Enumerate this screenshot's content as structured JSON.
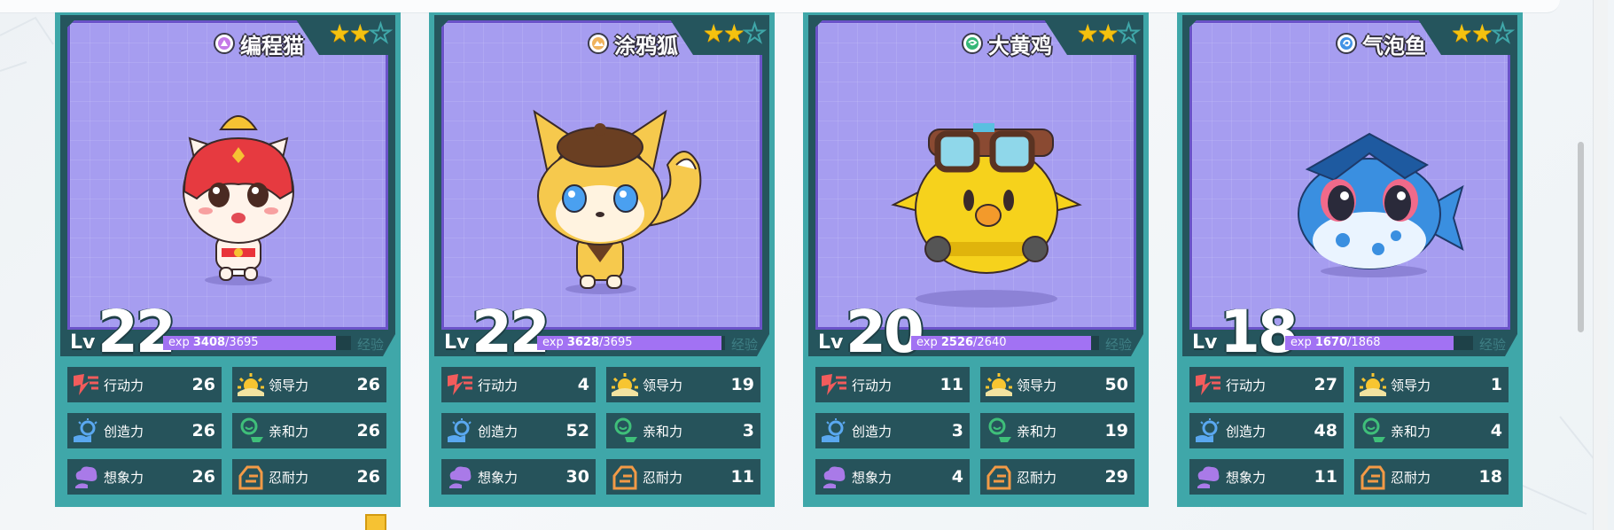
{
  "stat_labels": {
    "action": "行动力",
    "leadership": "领导力",
    "creativity": "创造力",
    "affinity": "亲和力",
    "imagination": "想象力",
    "endurance": "忍耐力"
  },
  "exp_caption": "经验",
  "level_prefix": "Lv",
  "exp_prefix": "exp",
  "cards": [
    {
      "name": "编程猫",
      "element_icon": "pink-circle-triangle-icon",
      "element_color": "#b96be0",
      "stars": 2,
      "max_stars": 3,
      "level": "22",
      "exp_current": "3408",
      "exp_total": "/3695",
      "exp_fraction": 0.922,
      "stats": {
        "action": "26",
        "leadership": "26",
        "creativity": "26",
        "affinity": "26",
        "imagination": "26",
        "endurance": "26"
      }
    },
    {
      "name": "涂鸦狐",
      "element_icon": "orange-mountain-icon",
      "element_color": "#e3a24a",
      "stars": 2,
      "max_stars": 3,
      "level": "22",
      "exp_current": "3628",
      "exp_total": "/3695",
      "exp_fraction": 0.982,
      "stats": {
        "action": "4",
        "leadership": "19",
        "creativity": "52",
        "affinity": "3",
        "imagination": "30",
        "endurance": "11"
      }
    },
    {
      "name": "大黄鸡",
      "element_icon": "green-wind-swirl-icon",
      "element_color": "#2fae6a",
      "stars": 2,
      "max_stars": 3,
      "level": "20",
      "exp_current": "2526",
      "exp_total": "/2640",
      "exp_fraction": 0.957,
      "stats": {
        "action": "11",
        "leadership": "50",
        "creativity": "3",
        "affinity": "19",
        "imagination": "4",
        "endurance": "29"
      }
    },
    {
      "name": "气泡鱼",
      "element_icon": "blue-water-swirl-icon",
      "element_color": "#3b8fe0",
      "stars": 2,
      "max_stars": 3,
      "level": "18",
      "exp_current": "1670",
      "exp_total": "/1868",
      "exp_fraction": 0.894,
      "stats": {
        "action": "27",
        "leadership": "1",
        "creativity": "48",
        "affinity": "4",
        "imagination": "11",
        "endurance": "18"
      }
    }
  ]
}
